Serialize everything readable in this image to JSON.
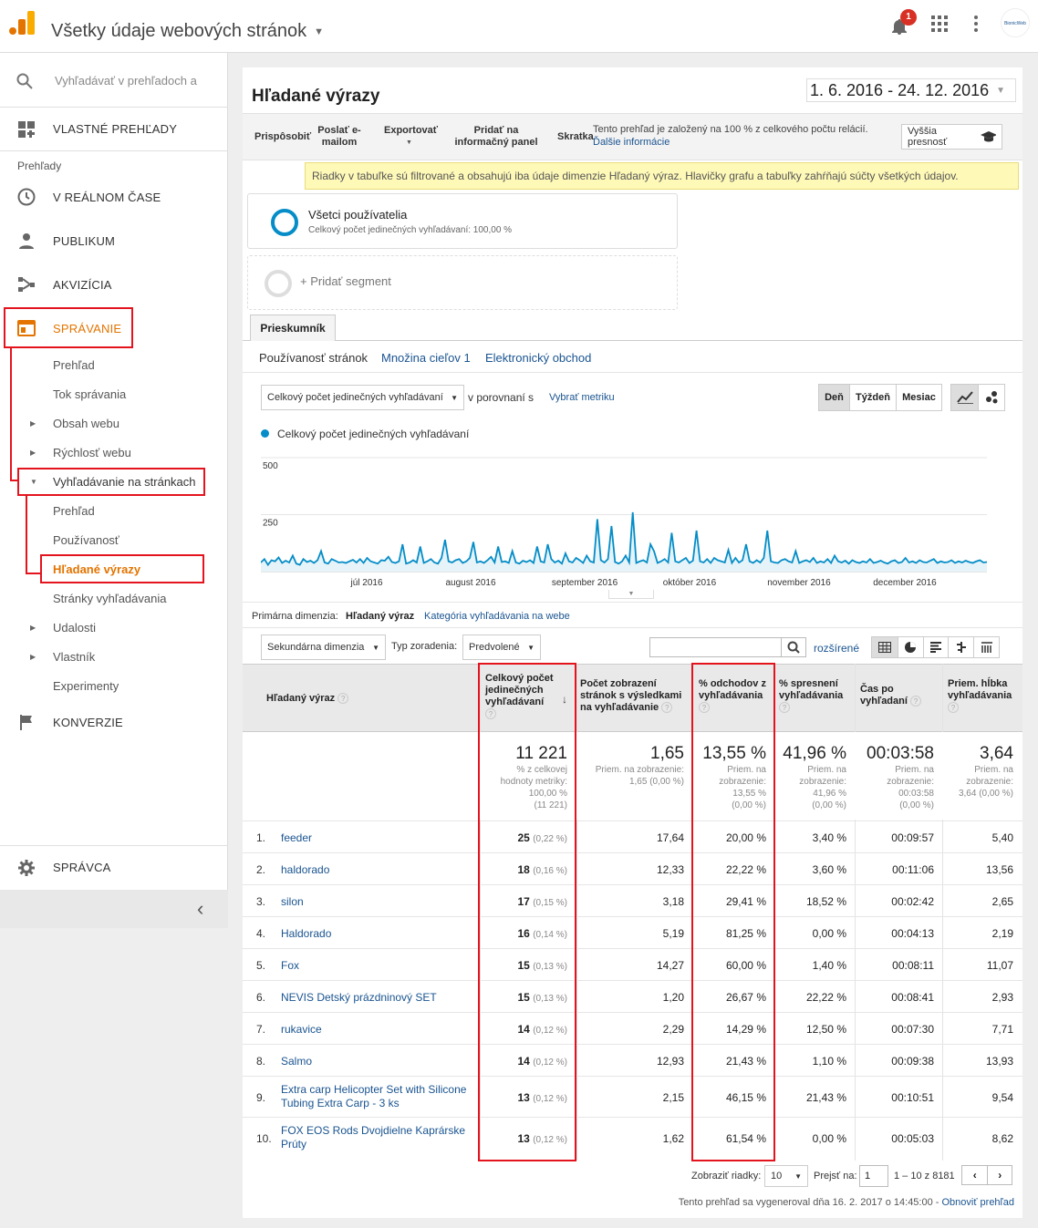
{
  "header": {
    "title": "Všetky údaje webových stránok",
    "notif_count": "1",
    "avatar_text": "BionicWeb"
  },
  "sidebar": {
    "search_placeholder": "Vyhľadávať v prehľadoch a",
    "custom_reports": "VLASTNÉ PREHĽADY",
    "reports_heading": "Prehľady",
    "realtime": "V REÁLNOM ČASE",
    "audience": "PUBLIKUM",
    "acquisition": "AKVIZÍCIA",
    "behavior": "SPRÁVANIE",
    "behavior_items": [
      "Prehľad",
      "Tok správania",
      "Obsah webu",
      "Rýchlosť webu",
      "Vyhľadávanie na stránkach"
    ],
    "site_search_items": [
      "Prehľad",
      "Používanosť",
      "Hľadané výrazy",
      "Stránky vyhľadávania"
    ],
    "more_items": [
      "Udalosti",
      "Vlastník",
      "Experimenty"
    ],
    "conversions": "KONVERZIE",
    "admin": "SPRÁVCA",
    "collapse": "‹"
  },
  "report": {
    "title": "Hľadané výrazy",
    "date_range": "1. 6. 2016 - 24. 12. 2016",
    "toolbar": {
      "customize": "Prispôsobiť",
      "email": "Poslať e-mailom",
      "export": "Exportovať",
      "dashboard": "Pridať na informačný panel",
      "shortcut": "Skratka",
      "sampling_text": "Tento prehľad je založený na 100 % z celkového počtu relácií.",
      "more_info": "Ďalšie informácie",
      "precision": "Vyššia presnosť"
    },
    "filter_notice": "Riadky v tabuľke sú filtrované a obsahujú iba údaje dimenzie Hľadaný výraz. Hlavičky grafu a tabuľky zahŕňajú súčty všetkých údajov.",
    "segment": {
      "name": "Všetci používatelia",
      "detail": "Celkový počet jedinečných vyhľadávaní: 100,00 %",
      "add": "+ Pridať segment"
    },
    "explorer_tab": "Prieskumník",
    "subtabs": [
      "Používanosť stránok",
      "Množina cieľov 1",
      "Elektronický obchod"
    ],
    "metric_select": "Celkový počet jedinečných vyhľadávaní",
    "compare_label": "v porovnaní s",
    "choose_metric": "Vybrať metriku",
    "period_buttons": [
      "Deň",
      "Týždeň",
      "Mesiac"
    ],
    "primary_dim_label": "Primárna dimenzia:",
    "primary_dim_value": "Hľadaný výraz",
    "primary_dim_alt": "Kategória vyhľadávania na webe",
    "secondary_dim": "Sekundárna dimenzia",
    "sort_label": "Typ zoradenia:",
    "sort_value": "Predvolené",
    "advanced": "rozšírené",
    "footer": {
      "show_rows": "Zobraziť riadky:",
      "rows_value": "10",
      "goto": "Prejsť na:",
      "goto_value": "1",
      "range": "1 – 10 z 8181",
      "generated": "Tento prehľad sa vygeneroval dňa 16. 2. 2017 o 14:45:00 -",
      "refresh": "Obnoviť prehľad"
    }
  },
  "chart_data": {
    "type": "line",
    "series": [
      {
        "name": "Celkový počet jedinečných vyhľadávaní"
      }
    ],
    "ylim": [
      0,
      500
    ],
    "yticks": [
      "500",
      "250"
    ],
    "xticks": [
      "júl 2016",
      "august 2016",
      "september 2016",
      "október 2016",
      "november 2016",
      "december 2016"
    ],
    "x": "daily 1.6.2016 – 24.12.2016",
    "values": [
      40,
      55,
      30,
      50,
      45,
      62,
      38,
      48,
      40,
      70,
      35,
      30,
      55,
      42,
      48,
      38,
      50,
      90,
      40,
      35,
      55,
      48,
      40,
      42,
      38,
      45,
      52,
      40,
      55,
      38,
      60,
      45,
      40,
      35,
      50,
      48,
      65,
      42,
      38,
      45,
      120,
      35,
      40,
      50,
      40,
      110,
      38,
      45,
      55,
      40,
      35,
      60,
      140,
      45,
      40,
      50,
      55,
      38,
      45,
      60,
      130,
      40,
      45,
      38,
      50,
      65,
      40,
      110,
      42,
      45,
      38,
      90,
      40,
      35,
      48,
      42,
      50,
      38,
      110,
      45,
      40,
      120,
      55,
      40,
      48,
      35,
      80,
      45,
      40,
      60,
      50,
      38,
      70,
      45,
      40,
      230,
      50,
      40,
      55,
      200,
      42,
      35,
      45,
      70,
      40,
      260,
      38,
      45,
      50,
      40,
      120,
      90,
      38,
      45,
      55,
      40,
      170,
      45,
      40,
      50,
      60,
      38,
      48,
      180,
      45,
      40,
      55,
      38,
      60,
      50,
      45,
      40,
      95,
      38,
      60,
      40,
      50,
      120,
      45,
      38,
      50,
      40,
      60,
      180,
      45,
      40,
      38,
      50,
      55,
      45,
      40,
      90,
      38,
      45,
      50,
      42,
      60,
      38,
      45,
      40,
      55,
      38,
      70,
      45,
      40,
      48,
      35,
      50,
      42,
      38,
      45,
      40,
      55,
      38,
      42,
      48,
      40,
      35,
      45,
      50,
      38,
      42,
      60,
      40,
      45,
      38,
      50,
      42,
      40,
      48,
      55,
      38,
      45,
      40,
      42,
      50,
      38,
      45,
      40,
      48,
      42,
      38,
      45,
      50,
      40,
      42
    ]
  },
  "table": {
    "headers": [
      "Hľadaný výraz",
      "Celkový počet jedinečných vyhľadávaní",
      "Počet zobrazení stránok s výsledkami na vyhľadávanie",
      "% odchodov z vyhľadávania",
      "% spresnení vyhľadávania",
      "Čas po vyhľadaní",
      "Priem. hĺbka vyhľadávania"
    ],
    "totals": [
      {
        "big": "11 221",
        "sub": [
          "% z celkovej",
          "hodnoty metriky:",
          "100,00 %",
          "(11 221)"
        ]
      },
      {
        "big": "1,65",
        "sub": [
          "Priem. na zobrazenie:",
          "1,65 (0,00 %)"
        ]
      },
      {
        "big": "13,55 %",
        "sub": [
          "Priem. na",
          "zobrazenie:",
          "13,55 %",
          "(0,00 %)"
        ]
      },
      {
        "big": "41,96 %",
        "sub": [
          "Priem. na",
          "zobrazenie:",
          "41,96 %",
          "(0,00 %)"
        ]
      },
      {
        "big": "00:03:58",
        "sub": [
          "Priem. na",
          "zobrazenie:",
          "00:03:58",
          "(0,00 %)"
        ]
      },
      {
        "big": "3,64",
        "sub": [
          "Priem. na",
          "zobrazenie:",
          "3,64 (0,00 %)"
        ]
      }
    ],
    "rows": [
      {
        "n": "1.",
        "term": "feeder",
        "u": "25",
        "pct": "(0,22 %)",
        "pv": "17,64",
        "ex": "20,00 %",
        "rf": "3,40 %",
        "t": "00:09:57",
        "d": "5,40"
      },
      {
        "n": "2.",
        "term": "haldorado",
        "u": "18",
        "pct": "(0,16 %)",
        "pv": "12,33",
        "ex": "22,22 %",
        "rf": "3,60 %",
        "t": "00:11:06",
        "d": "13,56"
      },
      {
        "n": "3.",
        "term": "silon",
        "u": "17",
        "pct": "(0,15 %)",
        "pv": "3,18",
        "ex": "29,41 %",
        "rf": "18,52 %",
        "t": "00:02:42",
        "d": "2,65"
      },
      {
        "n": "4.",
        "term": "Haldorado",
        "u": "16",
        "pct": "(0,14 %)",
        "pv": "5,19",
        "ex": "81,25 %",
        "rf": "0,00 %",
        "t": "00:04:13",
        "d": "2,19"
      },
      {
        "n": "5.",
        "term": "Fox",
        "u": "15",
        "pct": "(0,13 %)",
        "pv": "14,27",
        "ex": "60,00 %",
        "rf": "1,40 %",
        "t": "00:08:11",
        "d": "11,07"
      },
      {
        "n": "6.",
        "term": "NEVIS Detský prázdninový SET",
        "u": "15",
        "pct": "(0,13 %)",
        "pv": "1,20",
        "ex": "26,67 %",
        "rf": "22,22 %",
        "t": "00:08:41",
        "d": "2,93"
      },
      {
        "n": "7.",
        "term": "rukavice",
        "u": "14",
        "pct": "(0,12 %)",
        "pv": "2,29",
        "ex": "14,29 %",
        "rf": "12,50 %",
        "t": "00:07:30",
        "d": "7,71"
      },
      {
        "n": "8.",
        "term": "Salmo",
        "u": "14",
        "pct": "(0,12 %)",
        "pv": "12,93",
        "ex": "21,43 %",
        "rf": "1,10 %",
        "t": "00:09:38",
        "d": "13,93"
      },
      {
        "n": "9.",
        "term": "Extra carp Helicopter Set with Silicone Tubing Extra Carp - 3 ks",
        "u": "13",
        "pct": "(0,12 %)",
        "pv": "2,15",
        "ex": "46,15 %",
        "rf": "21,43 %",
        "t": "00:10:51",
        "d": "9,54"
      },
      {
        "n": "10.",
        "term": "FOX EOS Rods Dvojdielne Kaprárske Prúty",
        "u": "13",
        "pct": "(0,12 %)",
        "pv": "1,62",
        "ex": "61,54 %",
        "rf": "0,00 %",
        "t": "00:05:03",
        "d": "8,62"
      }
    ]
  }
}
